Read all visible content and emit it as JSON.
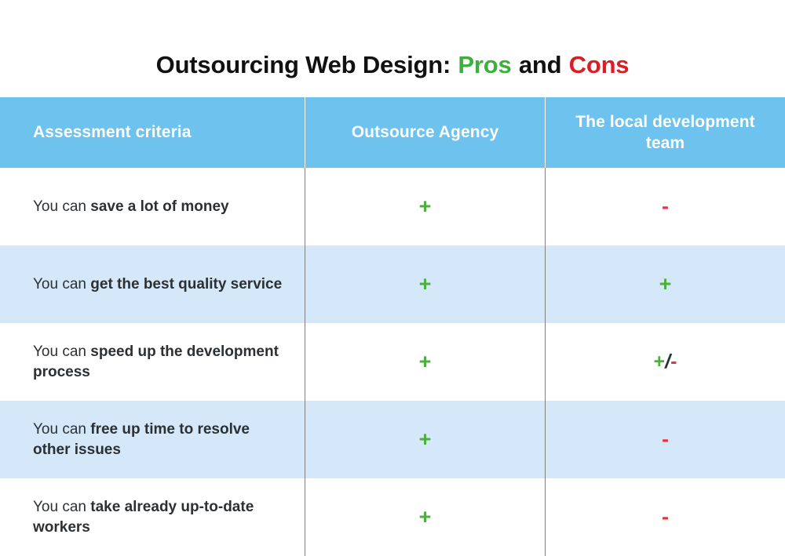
{
  "title": {
    "part1": "Outsourcing Web Design:",
    "pros": "Pros",
    "and": "and",
    "cons": "Cons"
  },
  "colors": {
    "header_bg": "#6DC2EE",
    "alt_row_bg": "#D4E8FA",
    "plus_green": "#4CAF3E",
    "minus_red": "#E8323C",
    "title_pros_green": "#3CAF3C",
    "title_cons_red": "#D61F26",
    "divider_gray": "#7F7F7F",
    "text_dark": "#2C3033"
  },
  "table": {
    "headers": {
      "criteria": "Assessment criteria",
      "outsource": "Outsource Agency",
      "local": "The local development team"
    },
    "rows": [
      {
        "lead": "You can ",
        "emphasis": "save a lot of money",
        "outsource": "+",
        "outsource_type": "plus",
        "local": "-",
        "local_type": "minus"
      },
      {
        "lead": "You can ",
        "emphasis": "get the best quality service",
        "outsource": "+",
        "outsource_type": "plus",
        "local": "+",
        "local_type": "plus"
      },
      {
        "lead": "You can ",
        "emphasis": "speed up the development process",
        "outsource": "+",
        "outsource_type": "plus",
        "local": "+/-",
        "local_type": "mixed",
        "local_plus": "+",
        "local_slash": "/",
        "local_minus": "-"
      },
      {
        "lead": "You can ",
        "emphasis": "free up time to resolve other issues",
        "outsource": "+",
        "outsource_type": "plus",
        "local": "-",
        "local_type": "minus"
      },
      {
        "lead": "You can ",
        "emphasis": "take already up-to-date workers",
        "outsource": "+",
        "outsource_type": "plus",
        "local": "-",
        "local_type": "minus"
      }
    ]
  }
}
